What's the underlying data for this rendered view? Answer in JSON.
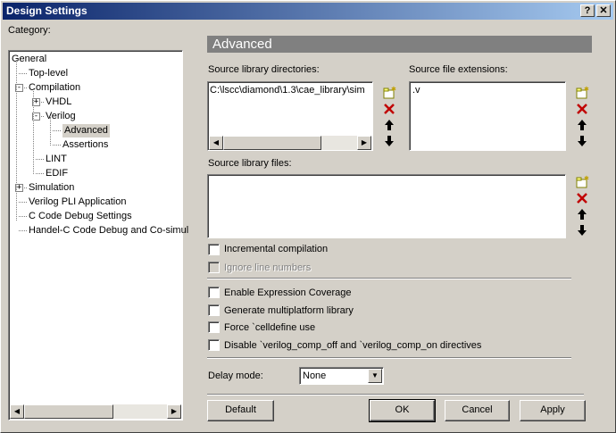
{
  "window": {
    "title": "Design Settings",
    "help_btn": "?",
    "close_btn": "X"
  },
  "category_label": "Category:",
  "tree": [
    {
      "label": "General",
      "depth": 0
    },
    {
      "label": "Top-level",
      "depth": 1
    },
    {
      "label": "Compilation",
      "depth": 1,
      "expander": "-"
    },
    {
      "label": "VHDL",
      "depth": 2,
      "expander": "+"
    },
    {
      "label": "Verilog",
      "depth": 2,
      "expander": "-"
    },
    {
      "label": "Advanced",
      "depth": 3,
      "selected": true
    },
    {
      "label": "Assertions",
      "depth": 3
    },
    {
      "label": "LINT",
      "depth": 2
    },
    {
      "label": "EDIF",
      "depth": 2
    },
    {
      "label": "Simulation",
      "depth": 1,
      "expander": "+"
    },
    {
      "label": "Verilog PLI Application",
      "depth": 1
    },
    {
      "label": "C Code Debug Settings",
      "depth": 1
    },
    {
      "label": "Handel-C Code Debug and Co-simul",
      "depth": 1
    }
  ],
  "panel": {
    "heading": "Advanced",
    "source_dirs_label": "Source library directories:",
    "source_dirs_value": "C:\\lscc\\diamond\\1.3\\cae_library\\sim",
    "source_ext_label": "Source file extensions:",
    "source_ext_value": ".v",
    "source_files_label": "Source library files:",
    "incremental": "Incremental compilation",
    "ignore_line": "Ignore line numbers",
    "expr_coverage": "Enable Expression Coverage",
    "multiplatform": "Generate multiplatform library",
    "celldefine": "Force `celldefine use",
    "disable_comp": "Disable `verilog_comp_off and `verilog_comp_on directives",
    "delay_mode_label": "Delay mode:",
    "delay_mode_value": "None"
  },
  "buttons": {
    "default": "Default",
    "ok": "OK",
    "cancel": "Cancel",
    "apply": "Apply"
  },
  "icons": {
    "new": "new-folder-icon",
    "delete": "delete-x-icon",
    "up": "arrow-up-icon",
    "down": "arrow-down-icon"
  }
}
